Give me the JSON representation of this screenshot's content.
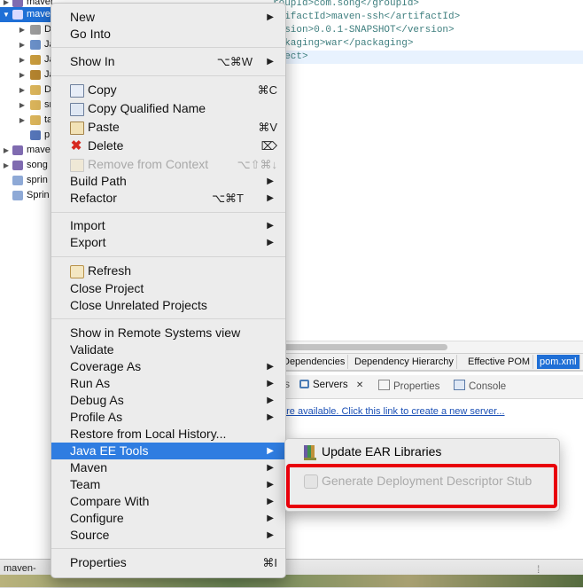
{
  "explorer": {
    "rows": [
      {
        "label": "maven",
        "expanded": false
      },
      {
        "label": "maven",
        "expanded": true
      },
      {
        "label": "D"
      },
      {
        "label": "Ja"
      },
      {
        "label": "Ja"
      },
      {
        "label": "Ja"
      },
      {
        "label": "D"
      },
      {
        "label": "sr"
      },
      {
        "label": "ta"
      },
      {
        "label": "p"
      },
      {
        "label": "mave"
      },
      {
        "label": "song"
      },
      {
        "label": "sprin"
      },
      {
        "label": "Sprin"
      }
    ]
  },
  "editor": {
    "lines": [
      {
        "pre": "<",
        "tag_open": "groupId",
        "text": "com.song",
        "tag_close": "groupId"
      },
      {
        "pre": "<",
        "tag_open": "artifactId",
        "text": "maven-ssh",
        "tag_close": "artifactId"
      },
      {
        "pre": "<",
        "tag_open": "version",
        "text": "0.0.1-SNAPSHOT",
        "tag_close": "version"
      },
      {
        "pre": "<",
        "tag_open": "packaging",
        "text": "war",
        "tag_close": "packaging"
      },
      {
        "text": "roject>"
      }
    ],
    "line1_text": "roupId>com.song</groupId>",
    "line2_text": "rtifactId>maven-ssh</artifactId>",
    "line3_text": "ersion>0.0.1-SNAPSHOT</version>",
    "line4_text": "ackaging>war</packaging>",
    "line5_text": "oject>"
  },
  "pom_tabs": [
    "Dependencies",
    "Dependency Hierarchy",
    "Effective POM",
    "pom.xml"
  ],
  "pom_tab_active": "pom.xml",
  "views": {
    "tabs": [
      "ts",
      "Servers",
      "Properties",
      "Console"
    ],
    "active": "Servers",
    "close_glyph": "✕",
    "message": "are available. Click this link to create a new server..."
  },
  "status": {
    "item": "maven-",
    "sep": "⁞"
  },
  "context_menu": {
    "items": [
      {
        "label": "New",
        "submenu": true
      },
      {
        "label": "Go Into"
      },
      {
        "sep": true
      },
      {
        "label": "Show In",
        "shortcut": "⌥⌘W",
        "submenu": true
      },
      {
        "sep": true
      },
      {
        "label": "Copy",
        "shortcut": "⌘C",
        "icon": "copy-icon"
      },
      {
        "label": "Copy Qualified Name",
        "icon": "copy-qualified-icon"
      },
      {
        "label": "Paste",
        "shortcut": "⌘V",
        "icon": "paste-icon"
      },
      {
        "label": "Delete",
        "shortcut": "⌦",
        "icon": "delete-icon"
      },
      {
        "label": "Remove from Context",
        "shortcut": "⌥⇧⌘↓",
        "icon": "remove-context-icon",
        "disabled": true
      },
      {
        "label": "Build Path",
        "submenu": true
      },
      {
        "label": "Refactor",
        "shortcut": "⌥⌘T",
        "submenu": true
      },
      {
        "sep": true
      },
      {
        "label": "Import",
        "submenu": true
      },
      {
        "label": "Export",
        "submenu": true
      },
      {
        "sep": true
      },
      {
        "label": "Refresh",
        "icon": "refresh-icon"
      },
      {
        "label": "Close Project"
      },
      {
        "label": "Close Unrelated Projects"
      },
      {
        "sep": true
      },
      {
        "label": "Show in Remote Systems view"
      },
      {
        "label": "Validate"
      },
      {
        "label": "Coverage As",
        "submenu": true
      },
      {
        "label": "Run As",
        "submenu": true
      },
      {
        "label": "Debug As",
        "submenu": true
      },
      {
        "label": "Profile As",
        "submenu": true
      },
      {
        "label": "Restore from Local History..."
      },
      {
        "label": "Java EE Tools",
        "submenu": true,
        "active": true
      },
      {
        "label": "Maven",
        "submenu": true
      },
      {
        "label": "Team",
        "submenu": true
      },
      {
        "label": "Compare With",
        "submenu": true
      },
      {
        "label": "Configure",
        "submenu": true
      },
      {
        "label": "Source",
        "submenu": true
      },
      {
        "sep": true
      },
      {
        "label": "Properties",
        "shortcut": "⌘I"
      }
    ]
  },
  "submenu": {
    "items": [
      {
        "label": "Update EAR Libraries",
        "icon": "ear-libraries-icon"
      },
      {
        "label": "Generate Deployment Descriptor Stub",
        "icon": "descriptor-stub-icon",
        "disabled": true
      }
    ]
  },
  "colors": {
    "selection": "#2f7de1",
    "callout": "#e8000b",
    "menu_bg": "#ececec",
    "link": "#1a4fb5"
  }
}
